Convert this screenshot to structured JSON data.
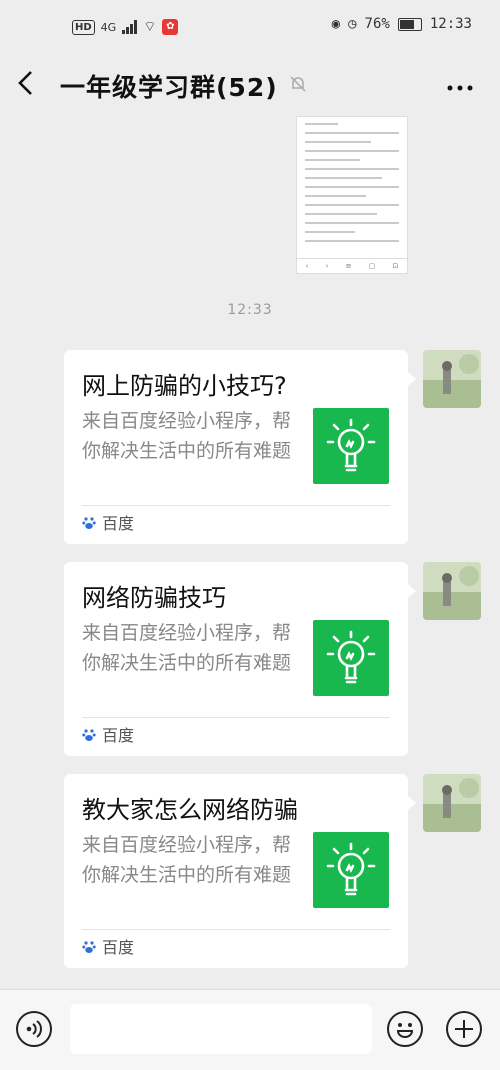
{
  "status_bar": {
    "network": "4G",
    "battery": "76%",
    "time": "12:33"
  },
  "header": {
    "title": "一年级学习群(52)",
    "back_icon": "chevron-left-icon",
    "mute_icon": "bell-off-icon",
    "more_icon": "more-dots-icon"
  },
  "chat": {
    "timestamp": "12:33",
    "cards": [
      {
        "title": "网上防骗的小技巧?",
        "desc": "来自百度经验小程序，帮你解决生活中的所有难题",
        "source": "百度"
      },
      {
        "title": "网络防骗技巧",
        "desc": "来自百度经验小程序，帮你解决生活中的所有难题",
        "source": "百度"
      },
      {
        "title": "教大家怎么网络防骗",
        "desc": "来自百度经验小程序，帮你解决生活中的所有难题",
        "source": "百度"
      }
    ]
  },
  "input_bar": {
    "voice_icon": "voice-icon",
    "emoji_icon": "emoji-icon",
    "plus_icon": "plus-icon"
  },
  "colors": {
    "background": "#ededed",
    "thumb_green": "#19b84f"
  }
}
